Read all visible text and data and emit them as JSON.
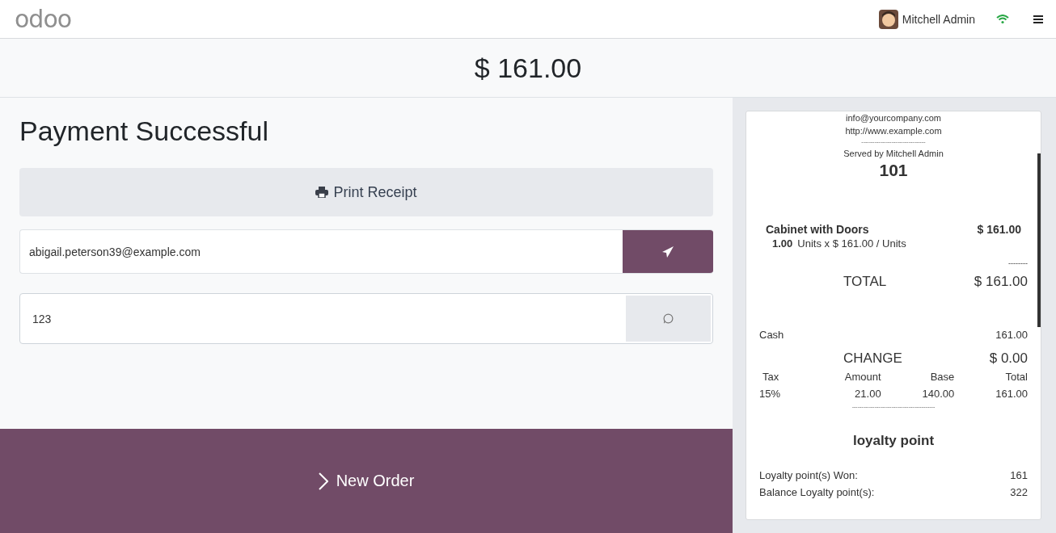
{
  "navbar": {
    "logo": "odoo",
    "user": "Mitchell Admin"
  },
  "amount_due": "$ 161.00",
  "payment": {
    "title": "Payment Successful",
    "print_button": "Print Receipt",
    "email": {
      "value": "abigail.peterson39@example.com"
    },
    "phone": {
      "value": "123"
    },
    "new_order_button": "New Order"
  },
  "receipt": {
    "header_lines": [
      "info@yourcompany.com",
      "http://www.example.com"
    ],
    "separator": "----------------------------------",
    "served_by": "Served by Mitchell Admin",
    "order_number": "101",
    "lines": [
      {
        "product": "Cabinet with Doors",
        "price": "$ 161.00",
        "quantity": "1.00",
        "unit_detail": "Units x $ 161.00 / Units"
      }
    ],
    "total_separator": "--------",
    "total_label": "TOTAL",
    "total_value": "$ 161.00",
    "payments": [
      {
        "method": "Cash",
        "amount": "161.00"
      }
    ],
    "change_label": "CHANGE",
    "change_value": "$ 0.00",
    "tax_columns": [
      "Tax",
      "Amount",
      "Base",
      "Total"
    ],
    "tax_rows": [
      [
        "15%",
        "21.00",
        "140.00",
        "161.00"
      ]
    ],
    "tax_separator": "--------------------------------------------",
    "loyalty_title": "loyalty point",
    "loyalty_rows": [
      {
        "label": "Loyalty point(s) Won:",
        "value": "161"
      },
      {
        "label": "Balance Loyalty point(s):",
        "value": "322"
      }
    ]
  }
}
